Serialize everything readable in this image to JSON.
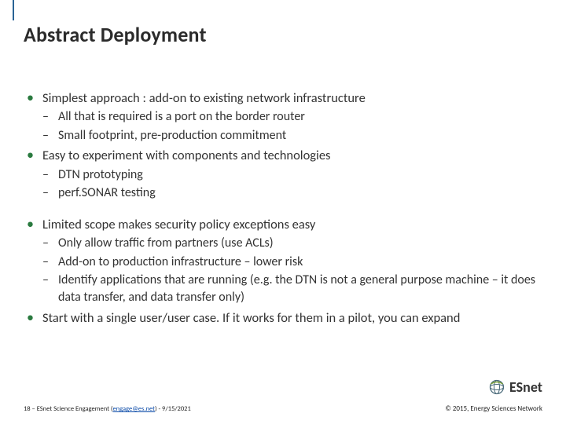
{
  "title": "Abstract Deployment",
  "bullets": [
    {
      "text": "Simplest approach : add-on to existing network infrastructure",
      "subs": [
        "All that is required is a port on the border router",
        "Small footprint, pre-production commitment"
      ]
    },
    {
      "text": "Easy to experiment with components and technologies",
      "subs": [
        "DTN prototyping",
        "perf.SONAR testing"
      ]
    },
    {
      "text": "Limited scope makes security policy exceptions easy",
      "subs": [
        "Only allow traffic from partners (use ACLs)",
        "Add-on to production infrastructure – lower risk",
        "Identify applications that are running (e.g. the DTN is not a general purpose machine – it does data transfer, and data transfer only)"
      ]
    },
    {
      "text": "Start with a single user/user case.  If it works for them in a pilot, you can expand",
      "subs": []
    }
  ],
  "logo": {
    "name": "ESnet"
  },
  "footer": {
    "page": "18",
    "sep1": " – ",
    "org": "ESnet Science Engagement (",
    "email": "engage@es.net",
    "close": ") - ",
    "date": "9/15/2021",
    "copyright": "© 2015, Energy Sciences Network"
  }
}
